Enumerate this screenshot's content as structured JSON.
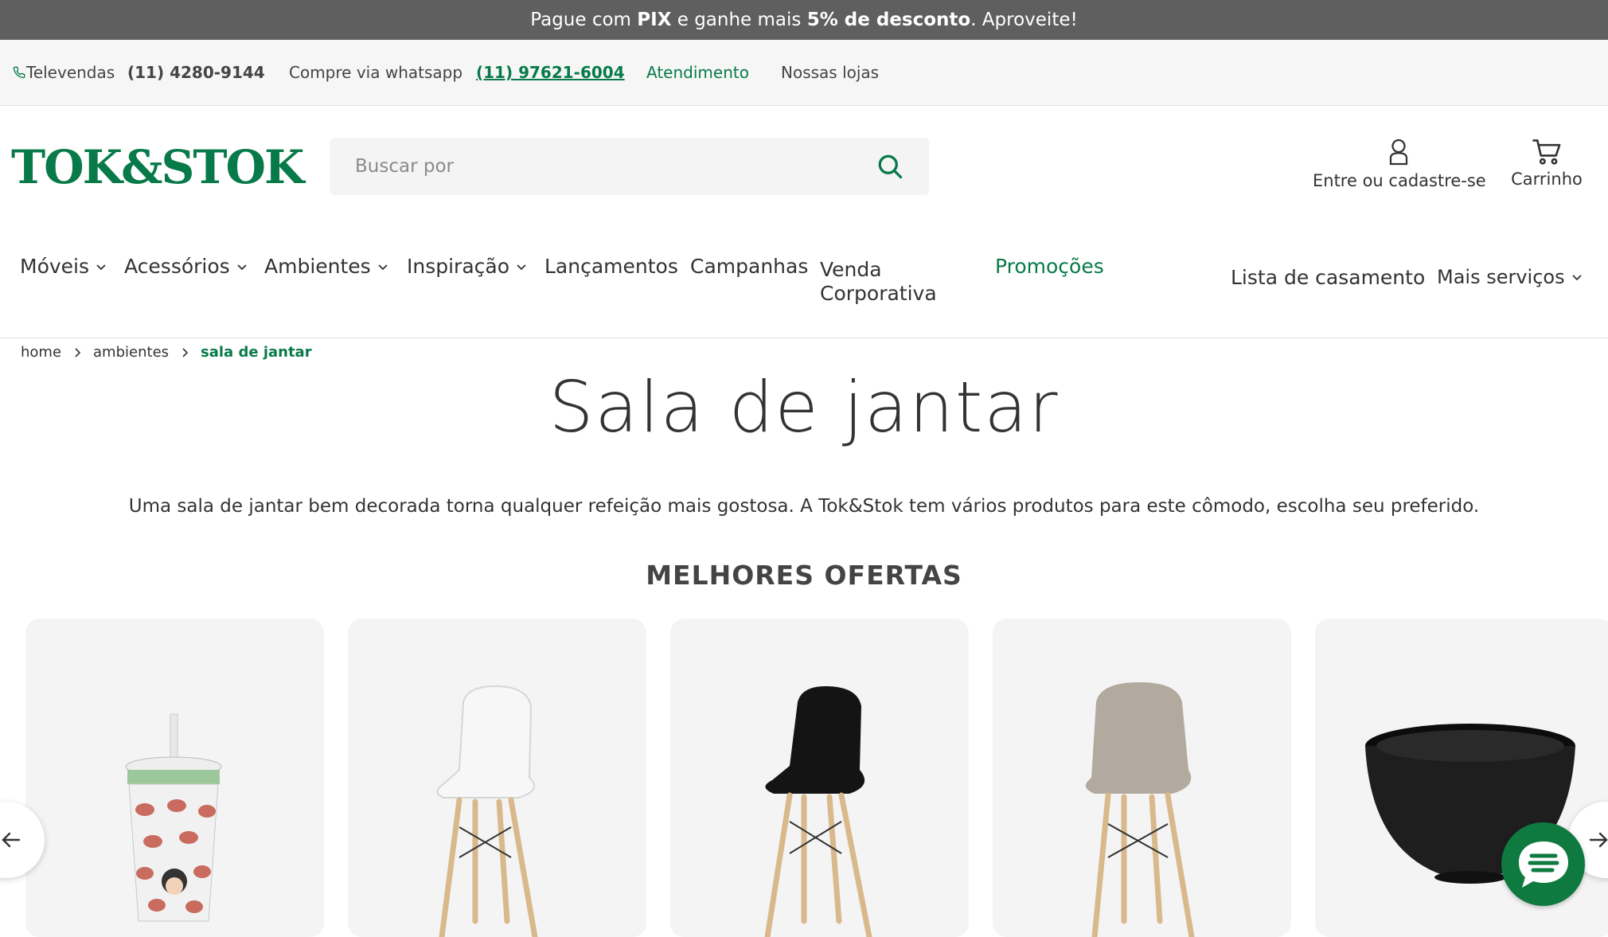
{
  "promo_bar": {
    "text_before": "Pague com ",
    "pix": "PIX",
    "text_middle": " e ganhe mais ",
    "discount": "5% de desconto",
    "text_after": ". Aproveite!"
  },
  "utility_bar": {
    "televendas_label": "Televendas",
    "televendas_phone": "(11) 4280-9144",
    "whatsapp_label": "Compre via whatsapp",
    "whatsapp_phone": "(11) 97621-6004",
    "atendimento": "Atendimento",
    "nossas_lojas": "Nossas lojas"
  },
  "header": {
    "logo_text": "TOK&STOK",
    "search_placeholder": "Buscar por",
    "account_label": "Entre ou cadastre-se",
    "cart_label": "Carrinho"
  },
  "nav": {
    "moveis": "Móveis",
    "acessorios": "Acessórios",
    "ambientes": "Ambientes",
    "inspiracao": "Inspiração",
    "lancamentos": "Lançamentos",
    "campanhas": "Campanhas",
    "venda_1": "Venda",
    "venda_2": "Corporativa",
    "promocoes": "Promoções",
    "lista_casamento": "Lista de casamento",
    "mais_servicos": "Mais serviços"
  },
  "breadcrumb": {
    "home": "home",
    "ambientes": "ambientes",
    "current": "sala de jantar"
  },
  "page": {
    "title": "Sala de jantar",
    "description": "Uma sala de jantar bem decorada torna qualquer refeição mais gostosa. A Tok&Stok tem vários produtos para este cômodo, escolha seu preferido.",
    "section_title": "MELHORES OFERTAS"
  },
  "colors": {
    "brand_green": "#087a4a",
    "promo_bg": "#5f5f5f",
    "chat_green": "#0e7a3f"
  },
  "icons": [
    "phone-icon",
    "search-icon",
    "user-icon",
    "cart-icon",
    "chevron-down-icon",
    "chevron-right-icon",
    "arrow-left-icon",
    "arrow-right-icon",
    "chat-icon"
  ]
}
